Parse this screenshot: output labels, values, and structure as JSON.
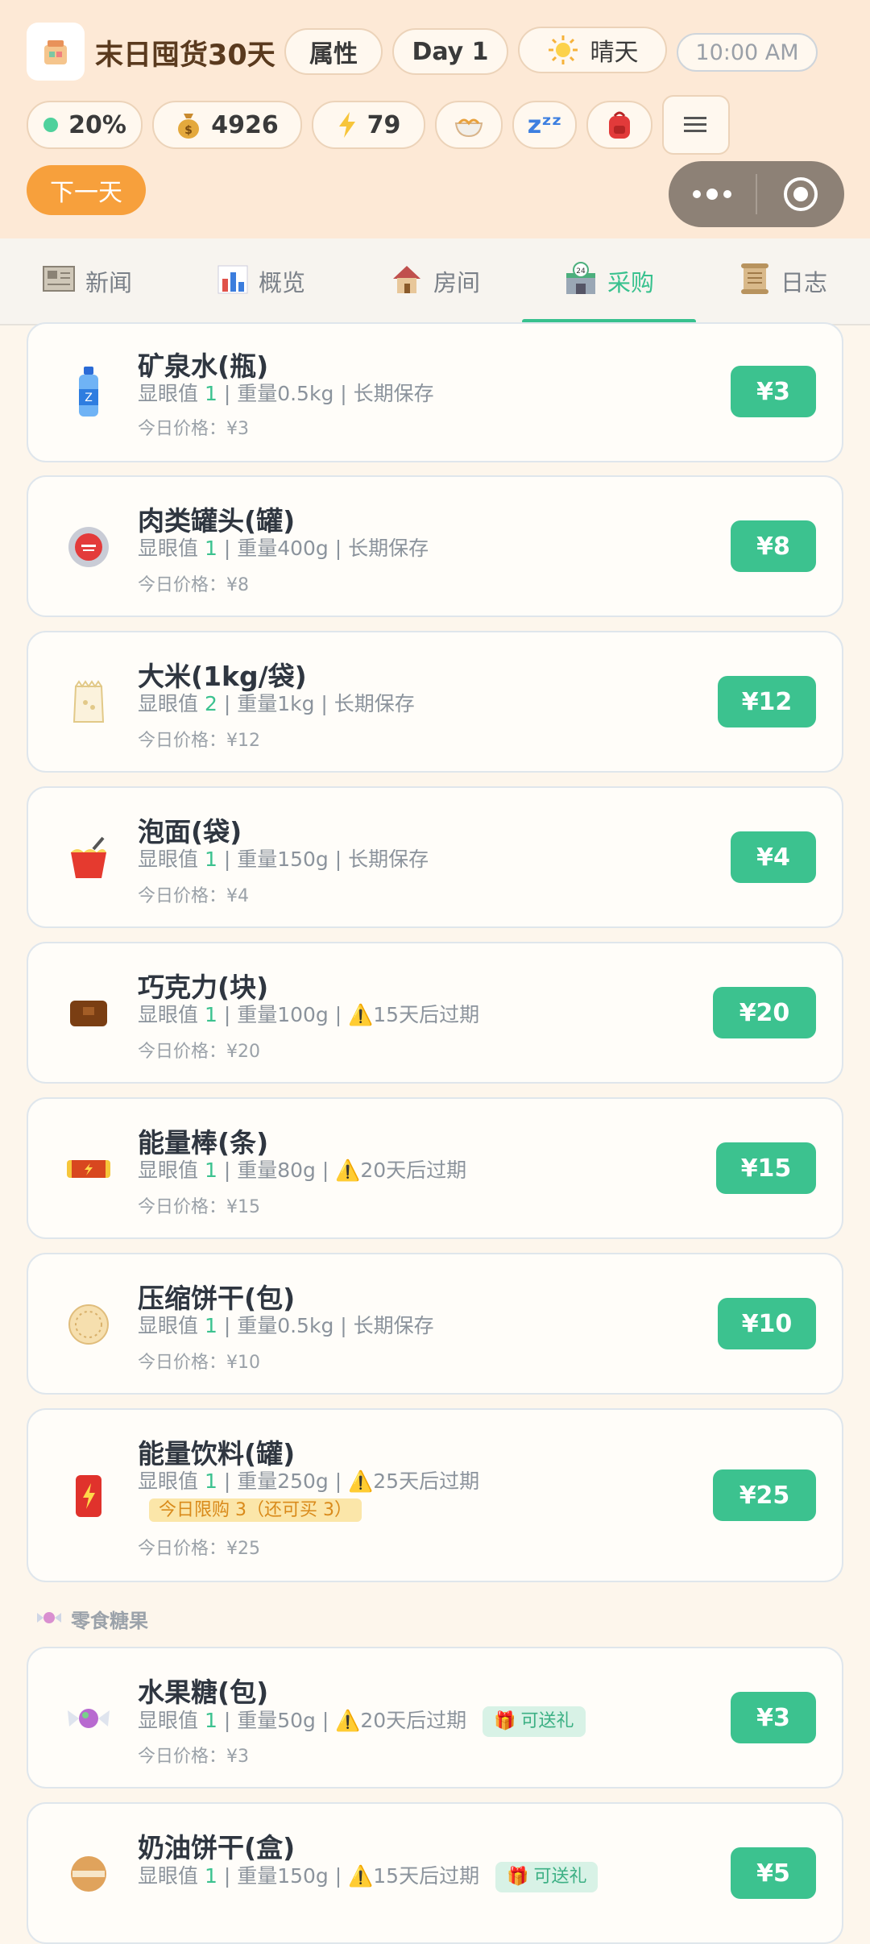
{
  "header": {
    "app_title": "末日囤货30天",
    "attr_button": "属性",
    "day_label": "Day 1",
    "weather": "晴天",
    "time": "10:00 AM",
    "stats": {
      "health_pct": "20%",
      "money": "4926",
      "energy": "79"
    },
    "next_day_button": "下一天"
  },
  "tabs": [
    {
      "label": "新闻",
      "icon": "newspaper-icon"
    },
    {
      "label": "概览",
      "icon": "bar-chart-icon"
    },
    {
      "label": "房间",
      "icon": "house-icon"
    },
    {
      "label": "采购",
      "icon": "store-24h-icon",
      "active": true
    },
    {
      "label": "日志",
      "icon": "scroll-icon"
    }
  ],
  "items": [
    {
      "name": "矿泉水(瓶)",
      "prominence_label": "显眼值",
      "prominence": "1",
      "weight": "重量0.5kg",
      "storage": "长期保存",
      "price_line": "今日价格：¥3",
      "buy_label": "¥3",
      "icon": "water-bottle-icon"
    },
    {
      "name": "肉类罐头(罐)",
      "prominence_label": "显眼值",
      "prominence": "1",
      "weight": "重量400g",
      "storage": "长期保存",
      "price_line": "今日价格：¥8",
      "buy_label": "¥8",
      "icon": "canned-meat-icon"
    },
    {
      "name": "大米(1kg/袋)",
      "prominence_label": "显眼值",
      "prominence": "2",
      "weight": "重量1kg",
      "storage": "长期保存",
      "price_line": "今日价格：¥12",
      "buy_label": "¥12",
      "icon": "rice-bag-icon"
    },
    {
      "name": "泡面(袋)",
      "prominence_label": "显眼值",
      "prominence": "1",
      "weight": "重量150g",
      "storage": "长期保存",
      "price_line": "今日价格：¥4",
      "buy_label": "¥4",
      "icon": "noodle-cup-icon"
    },
    {
      "name": "巧克力(块)",
      "prominence_label": "显眼值",
      "prominence": "1",
      "weight": "重量100g",
      "storage": "15天后过期",
      "price_line": "今日价格：¥20",
      "buy_label": "¥20",
      "icon": "chocolate-icon"
    },
    {
      "name": "能量棒(条)",
      "prominence_label": "显眼值",
      "prominence": "1",
      "weight": "重量80g",
      "storage": "20天后过期",
      "price_line": "今日价格：¥15",
      "buy_label": "¥15",
      "icon": "energy-bar-icon"
    },
    {
      "name": "压缩饼干(包)",
      "prominence_label": "显眼值",
      "prominence": "1",
      "weight": "重量0.5kg",
      "storage": "长期保存",
      "price_line": "今日价格：¥10",
      "buy_label": "¥10",
      "icon": "biscuit-icon"
    },
    {
      "name": "能量饮料(罐)",
      "prominence_label": "显眼值",
      "prominence": "1",
      "weight": "重量250g",
      "storage": "25天后过期",
      "limit_tag": "今日限购 3（还可买 3）",
      "price_line": "今日价格：¥25",
      "buy_label": "¥25",
      "icon": "energy-drink-icon"
    }
  ],
  "section_snacks": "零食糖果",
  "snacks": [
    {
      "name": "水果糖(包)",
      "prominence_label": "显眼值",
      "prominence": "1",
      "weight": "重量50g",
      "storage": "20天后过期",
      "gift_tag": "可送礼",
      "price_line": "今日价格：¥3",
      "buy_label": "¥3",
      "icon": "candy-icon"
    },
    {
      "name": "奶油饼干(盒)",
      "prominence_label": "显眼值",
      "prominence": "1",
      "weight": "重量150g",
      "storage": "15天后过期",
      "gift_tag": "可送礼",
      "buy_label": "¥5",
      "icon": "cookie-icon"
    }
  ],
  "colors": {
    "accent": "#3cc28f",
    "orange": "#f7a03c",
    "header_bg": "#fde9d6"
  }
}
